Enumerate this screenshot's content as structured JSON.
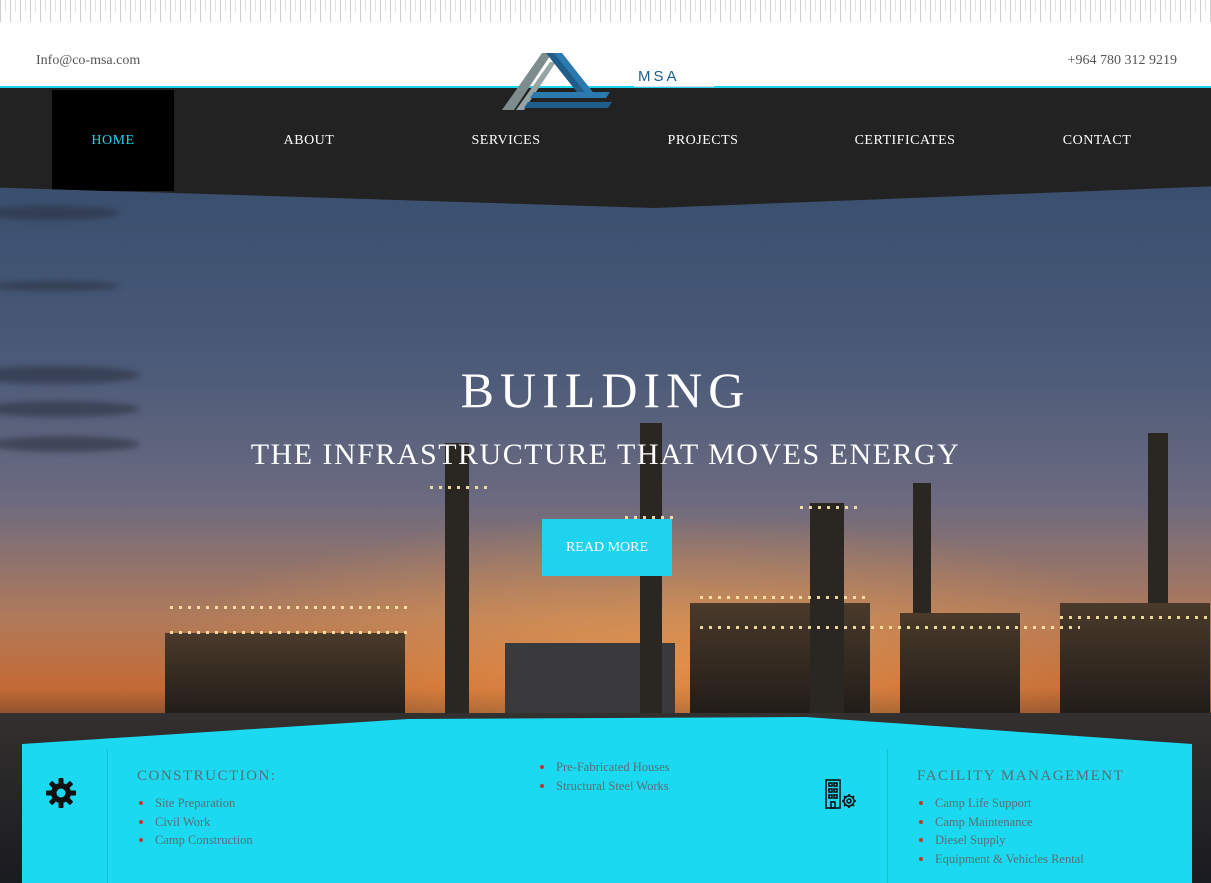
{
  "header": {
    "email": "Info@co-msa.com",
    "phone": "+964 780 312 9219",
    "logo_text": "MSA"
  },
  "nav": {
    "items": [
      {
        "label": "HOME",
        "active": true
      },
      {
        "label": "ABOUT",
        "active": false
      },
      {
        "label": "SERVICES",
        "active": false
      },
      {
        "label": "PROJECTS",
        "active": false
      },
      {
        "label": "CERTIFICATES",
        "active": false
      },
      {
        "label": "CONTACT",
        "active": false
      }
    ]
  },
  "hero": {
    "title": "BUILDING",
    "subtitle": "THE INFRASTRUCTURE THAT MOVES ENERGY",
    "button_label": "READ MORE"
  },
  "services": {
    "construction": {
      "title": "CONSTRUCTION:",
      "items": [
        "Site Preparation",
        "Civil Work",
        "Camp Construction"
      ],
      "icon": "gear-icon"
    },
    "construction_more": {
      "items": [
        "Pre-Fabricated Houses",
        "Structural Steel Works"
      ]
    },
    "facility": {
      "title": "FACILITY MANAGEMENT",
      "items": [
        "Camp Life Support",
        "Camp Maintenance",
        "Diesel Supply",
        "Equipment & Vehicles Rental"
      ],
      "icon": "building-gear-icon"
    }
  },
  "colors": {
    "accent": "#1fd2ee",
    "nav_bg": "#222222",
    "services_bg": "#1ad9f1"
  }
}
